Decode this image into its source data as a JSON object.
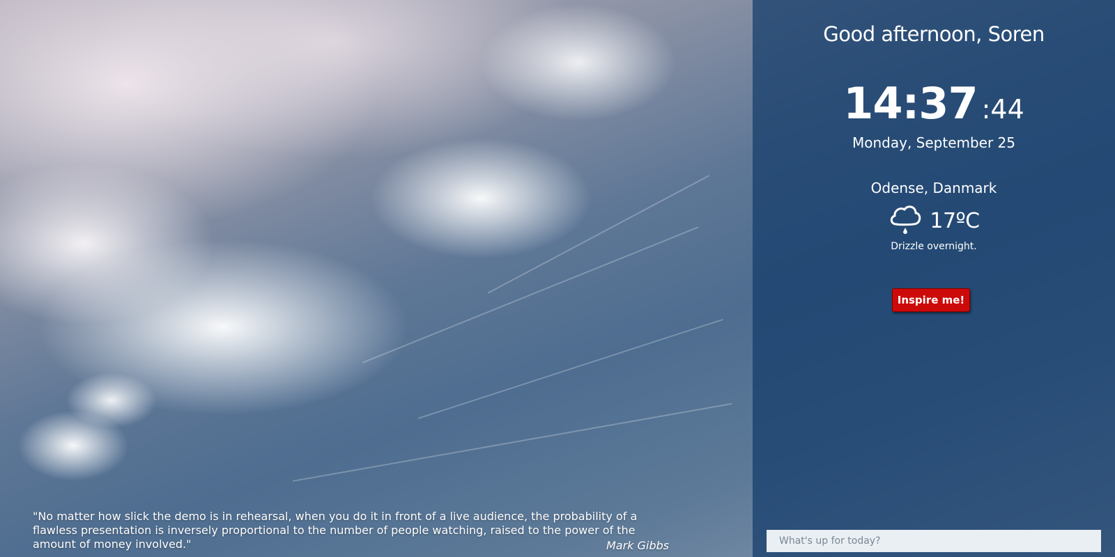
{
  "background": {
    "description_colors": {
      "sky_blue": "#4e6d90",
      "cloud_white": "#f5f0f3"
    }
  },
  "panel": {
    "greeting": "Good afternoon, Soren",
    "clock": {
      "hours_minutes": "14:37",
      "seconds": ":44"
    },
    "date": "Monday, September 25",
    "weather": {
      "location": "Odense, Danmark",
      "icon": "cloud-drizzle-icon",
      "temperature": "17ºC",
      "summary": "Drizzle overnight."
    },
    "inspire_button": {
      "label": "Inspire me!",
      "color": "#cc0a0a"
    },
    "todo": {
      "placeholder": "What's up for today?",
      "value": ""
    },
    "panel_color": "#143c69"
  },
  "quote": {
    "text": "\"No matter how slick the demo is in rehearsal, when you do it in front of a live audience, the probability of a flawless presentation is inversely proportional to the number of people watching, raised to the power of the amount of money involved.\"",
    "author": "Mark Gibbs"
  }
}
